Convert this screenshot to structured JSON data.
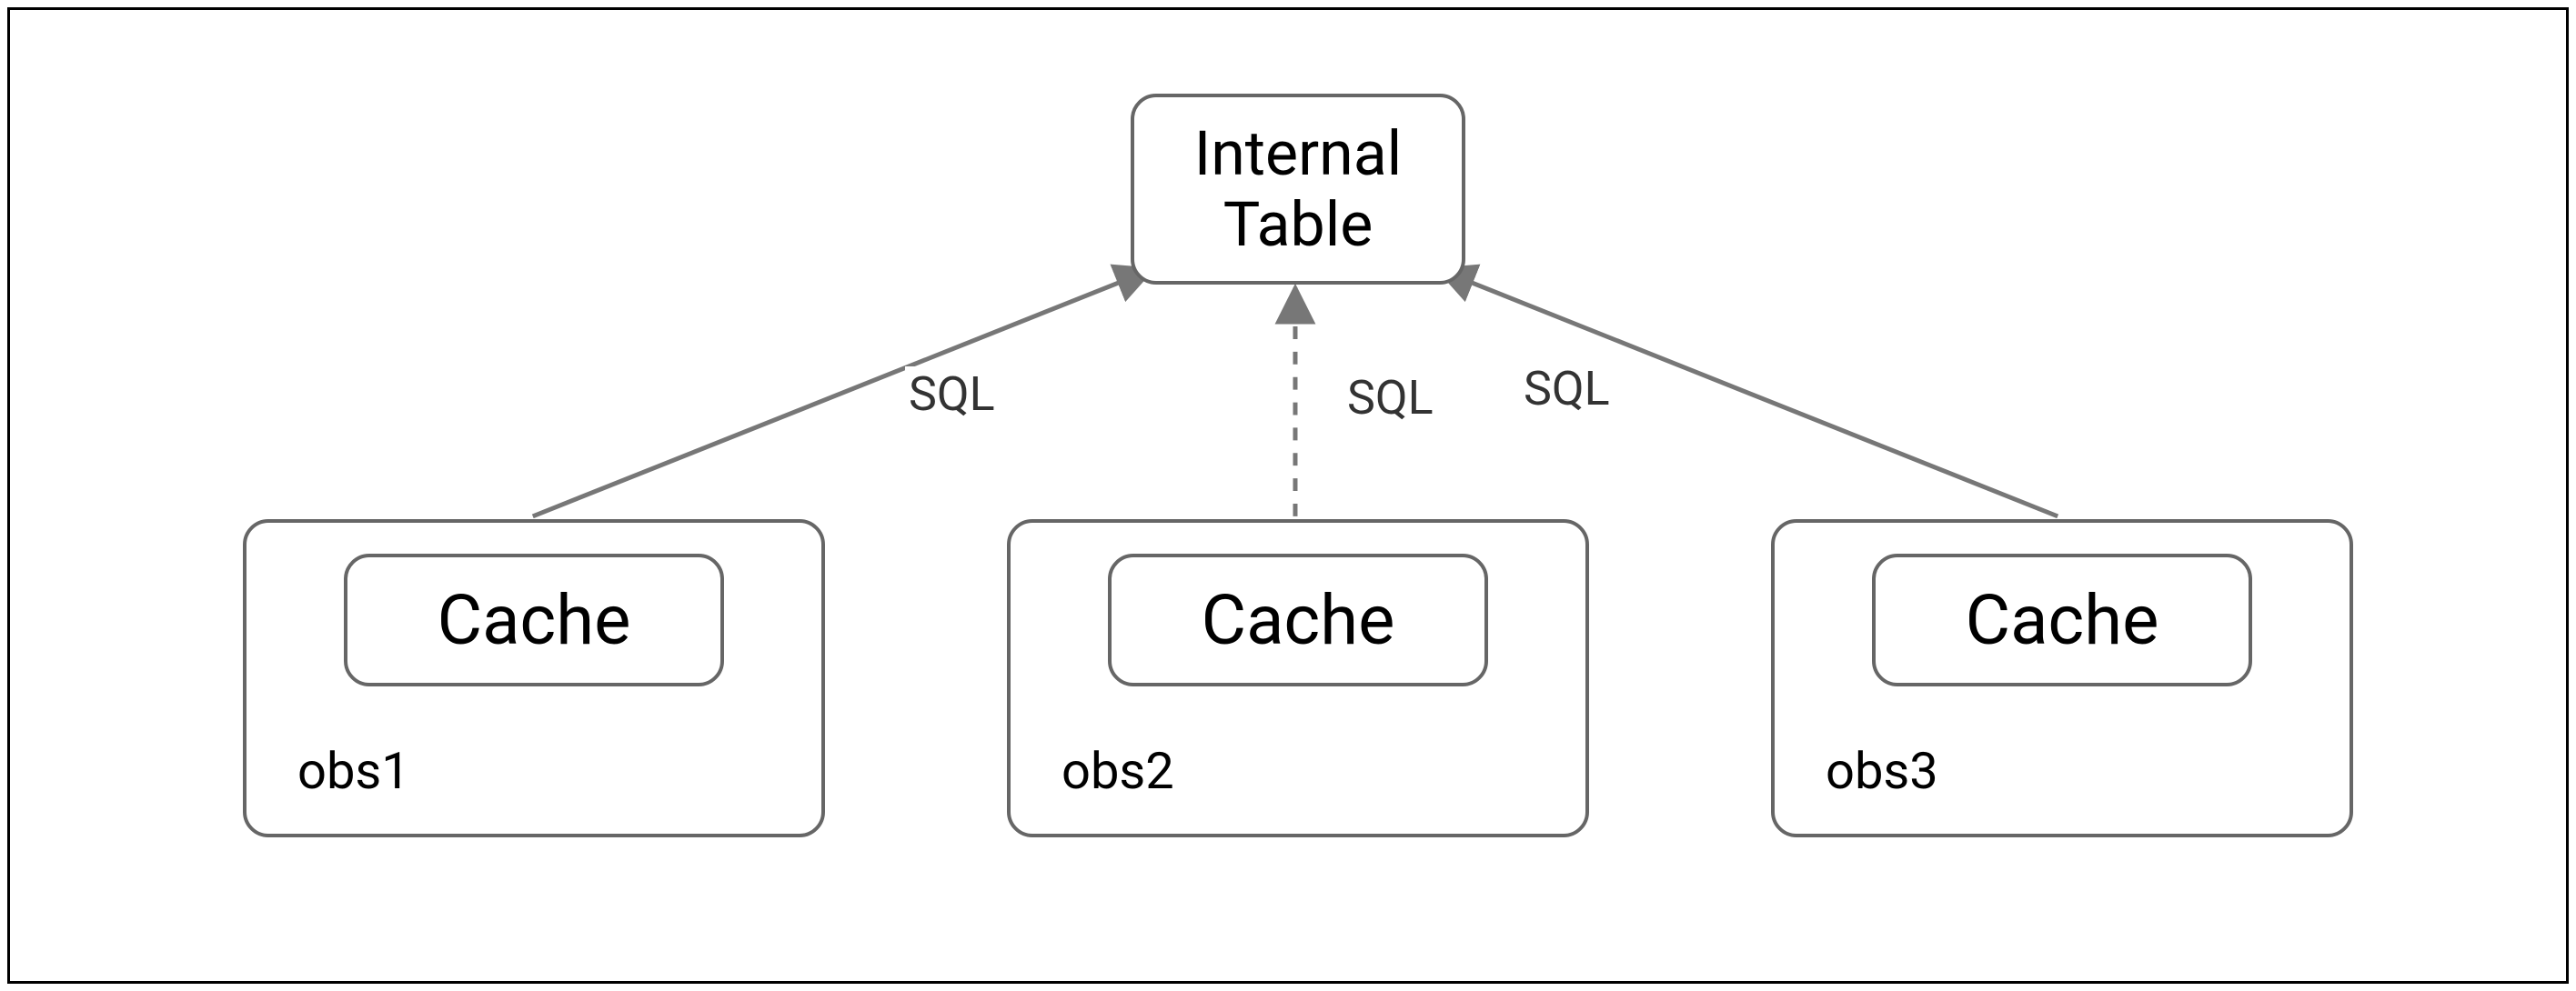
{
  "diagram": {
    "top_node": {
      "line1": "Internal",
      "line2": "Table"
    },
    "edges": [
      {
        "label": "SQL",
        "style": "solid"
      },
      {
        "label": "SQL",
        "style": "dashed"
      },
      {
        "label": "SQL",
        "style": "solid"
      }
    ],
    "observers": [
      {
        "cache_label": "Cache",
        "name": "obs1"
      },
      {
        "cache_label": "Cache",
        "name": "obs2"
      },
      {
        "cache_label": "Cache",
        "name": "obs3"
      }
    ]
  }
}
